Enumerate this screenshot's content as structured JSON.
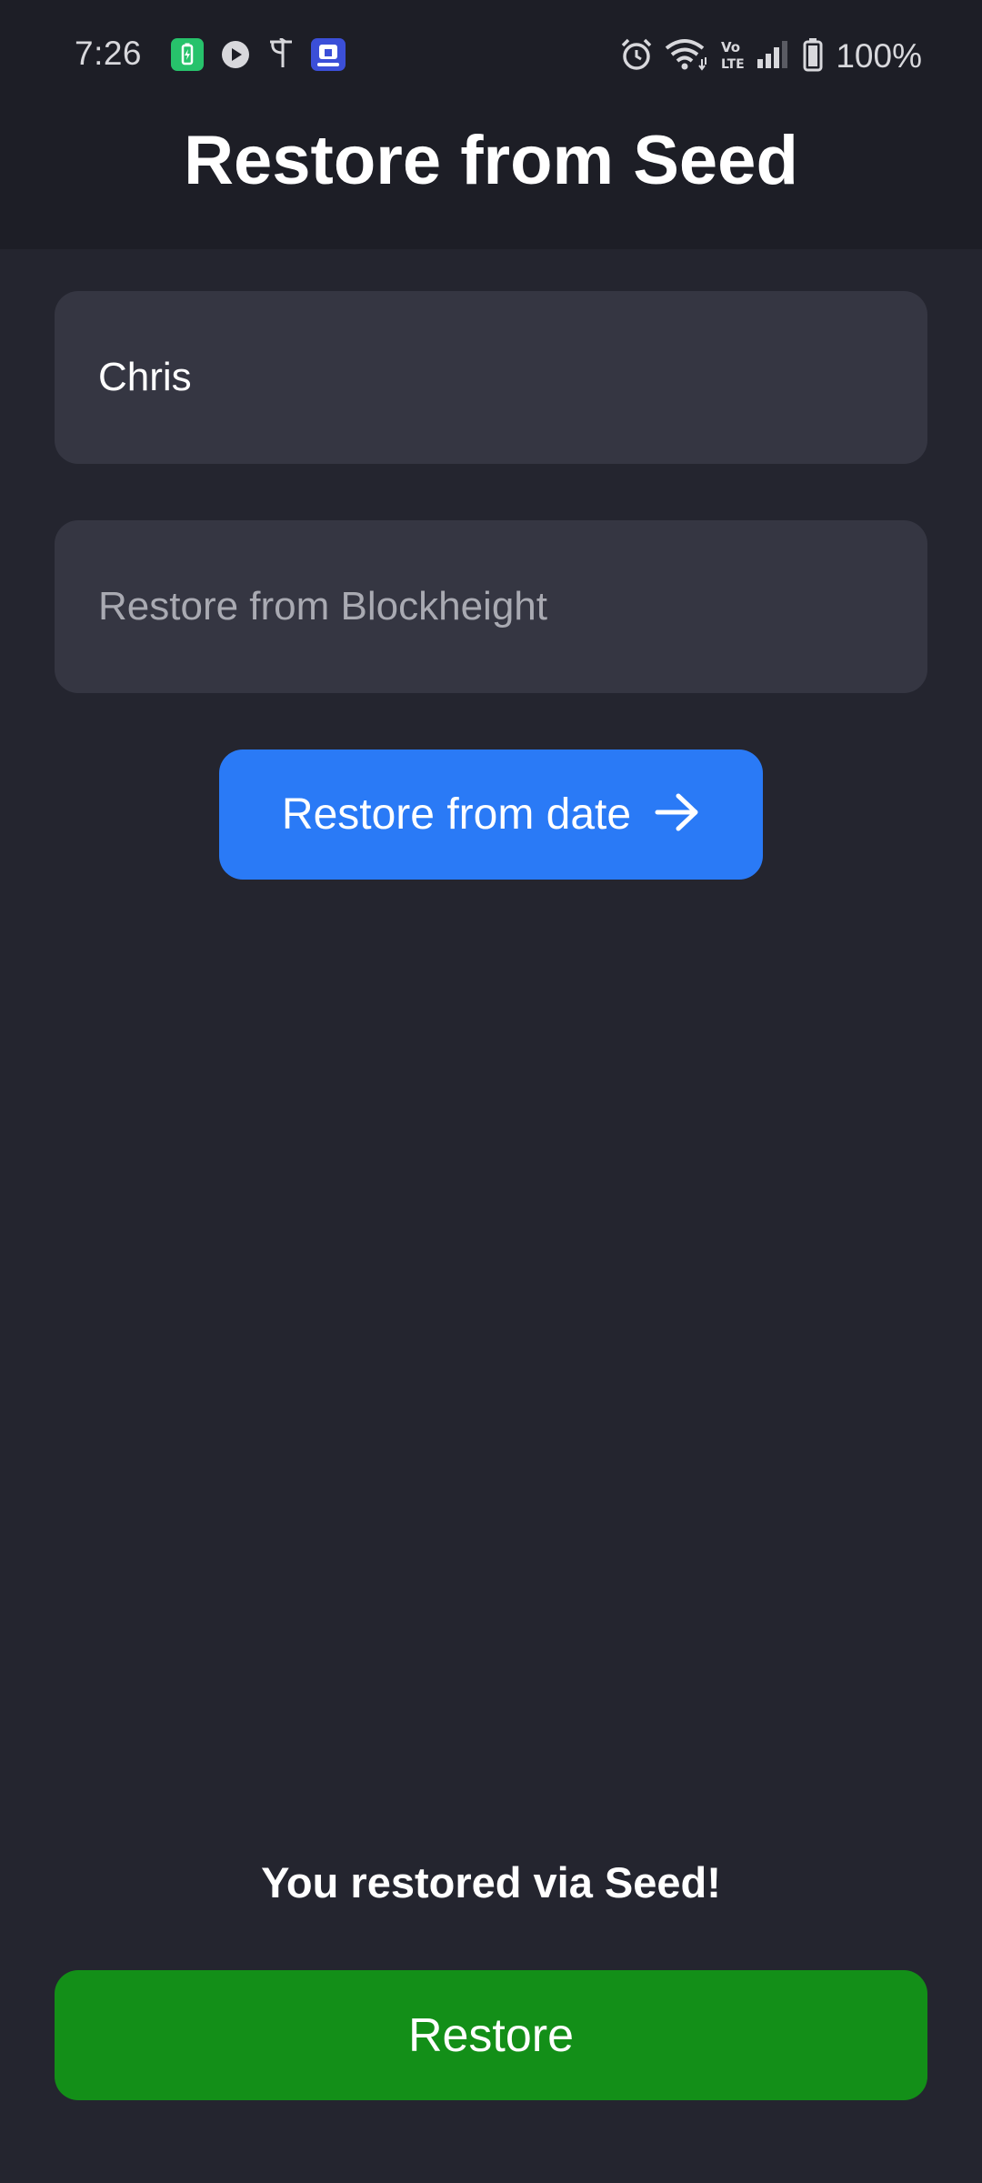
{
  "status_bar": {
    "time": "7:26",
    "battery_percent": "100%",
    "left_icons": [
      "battery-saver-app-icon",
      "play-icon",
      "phonepe-icon",
      "app-badge-icon"
    ],
    "right_icons": [
      "alarm-icon",
      "wifi-icon",
      "volte-icon",
      "signal-icon",
      "battery-icon"
    ]
  },
  "header": {
    "title": "Restore from Seed"
  },
  "form": {
    "name_value": "Chris",
    "blockheight_placeholder": "Restore from Blockheight",
    "date_button_label": "Restore from date"
  },
  "footer": {
    "message": "You restored via Seed!",
    "restore_button_label": "Restore"
  },
  "colors": {
    "background": "#24252f",
    "app_bar": "#1d1e26",
    "field": "#353642",
    "primary_button": "#2a7af6",
    "restore_button": "#138f18"
  }
}
